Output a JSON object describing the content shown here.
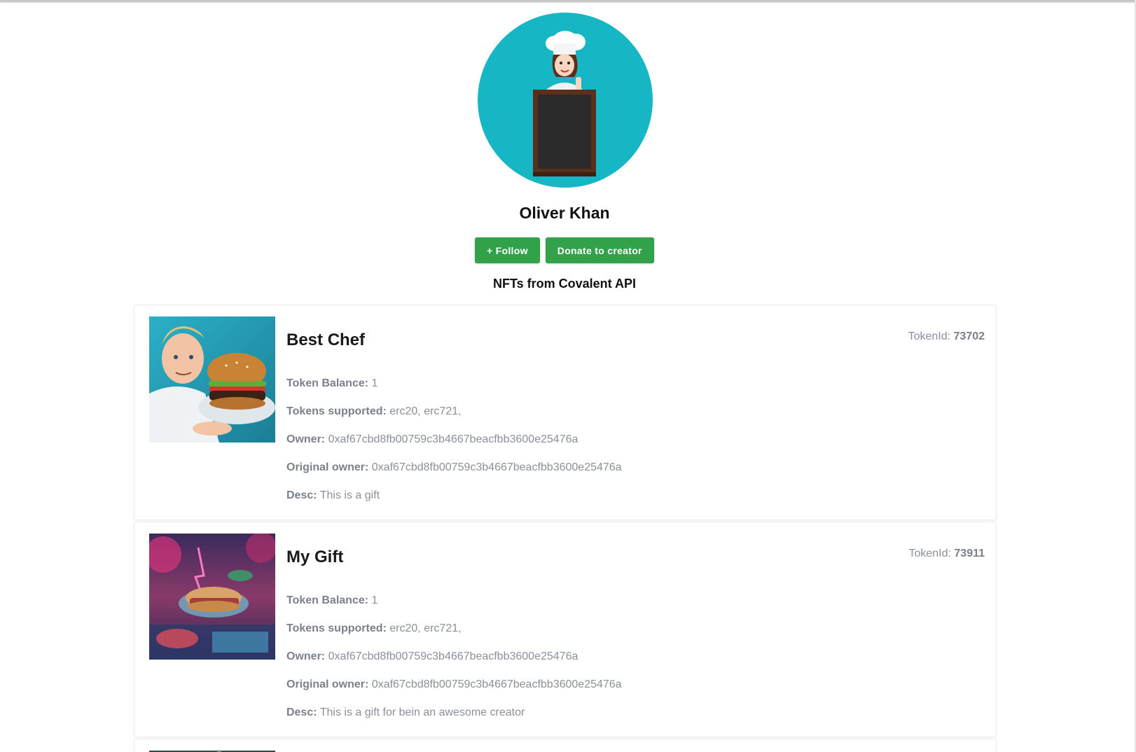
{
  "profile": {
    "name": "Oliver Khan",
    "follow_label": "+ Follow",
    "donate_label": "Donate to creator",
    "avatar_icon": "chef-avatar-icon"
  },
  "section": {
    "title": "NFTs from Covalent API"
  },
  "field_labels": {
    "balance": "Token Balance:",
    "supported": "Tokens supported:",
    "owner": "Owner:",
    "original_owner": "Original owner:",
    "desc": "Desc:",
    "token_id": "TokenId:"
  },
  "nfts": [
    {
      "title": "Best Chef",
      "token_id": "73702",
      "balance": "1",
      "supported": "erc20, erc721,",
      "owner": "0xaf67cbd8fb00759c3b4667beacfbb3600e25476a",
      "original_owner": "0xaf67cbd8fb00759c3b4667beacfbb3600e25476a",
      "desc": "This is a gift",
      "image_icon": "chef-burger-image"
    },
    {
      "title": "My Gift",
      "token_id": "73911",
      "balance": "1",
      "supported": "erc20, erc721,",
      "owner": "0xaf67cbd8fb00759c3b4667beacfbb3600e25476a",
      "original_owner": "0xaf67cbd8fb00759c3b4667beacfbb3600e25476a",
      "desc": "This is a gift for bein an awesome creator",
      "image_icon": "neon-sandwich-image"
    }
  ],
  "colors": {
    "accent": "#31a14a",
    "avatar_bg": "#17b6c4",
    "muted_text": "#8a8f9a"
  }
}
